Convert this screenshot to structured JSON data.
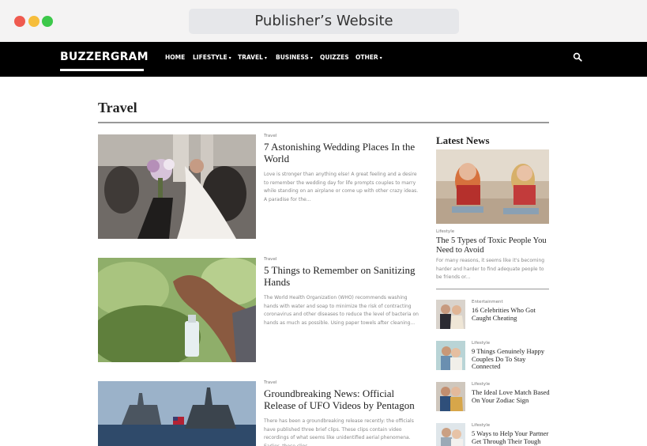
{
  "browser": {
    "address_text": "Publisher’s Website"
  },
  "nav": {
    "logo": "BUZZERGRAM",
    "items": [
      {
        "label": "HOME",
        "has_dropdown": false
      },
      {
        "label": "LIFESTYLE",
        "has_dropdown": true
      },
      {
        "label": "TRAVEL",
        "has_dropdown": true
      },
      {
        "label": "BUSINESS",
        "has_dropdown": true
      },
      {
        "label": "QUIZZES",
        "has_dropdown": false
      },
      {
        "label": "OTHER",
        "has_dropdown": true
      }
    ],
    "caret": "▾",
    "search_icon": "search-icon"
  },
  "section": {
    "title": "Travel"
  },
  "articles": [
    {
      "category": "Travel",
      "title": "7 Astonishing Wedding Places In the World",
      "excerpt": "Love is stronger than anything else! A great feeling and a desire to remember the wedding day for life prompts couples to marry while standing on an airplane or come up with other crazy ideas. A paradise for the..."
    },
    {
      "category": "Travel",
      "title": "5 Things to Remember on Sanitizing Hands",
      "excerpt": "The World Health Organization (WHO) recommends washing hands with water and soap to minimize the risk of contracting coronavirus and other diseases to reduce the level of bacteria on hands as much as possible. Using paper towels after cleaning..."
    },
    {
      "category": "Travel",
      "title": "Groundbreaking News: Official Release of UFO Videos by Pentagon",
      "excerpt": "There has been a groundbreaking release recently: the officials have published three brief clips. These clips contain video recordings of what seems like unidentified aerial phenomena. Earlier, these clips"
    }
  ],
  "sidebar": {
    "title": "Latest News",
    "hero": {
      "category": "Lifestyle",
      "title": "The 5 Types of Toxic People You Need to Avoid",
      "excerpt": "For many reasons, it seems like it's becoming harder and harder to find adequate people to be friends or..."
    },
    "items": [
      {
        "category": "Entertainment",
        "title": "16 Celebrities Who Got Caught Cheating"
      },
      {
        "category": "Lifestyle",
        "title": "9 Things Genuinely Happy Couples Do To Stay Connected"
      },
      {
        "category": "Lifestyle",
        "title": "The Ideal Love Match Based On Your Zodiac Sign"
      },
      {
        "category": "Lifestyle",
        "title": "5 Ways to Help Your Partner Get Through Their Tough"
      }
    ]
  }
}
